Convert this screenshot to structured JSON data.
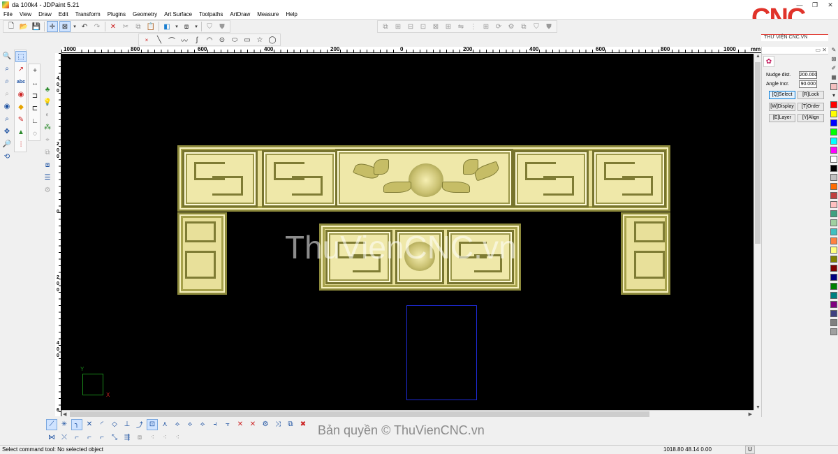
{
  "window": {
    "title": "da 100k4 - JDPaint 5.21",
    "controls": [
      "—",
      "❐",
      "✕"
    ]
  },
  "menu": [
    "File",
    "View",
    "Draw",
    "Edit",
    "Transform",
    "Plugins",
    "Geometry",
    "Art Surface",
    "Toolpaths",
    "ArtDraw",
    "Measure",
    "Help"
  ],
  "ruler": {
    "unit": "mm",
    "labels": [
      "1000",
      "800",
      "600",
      "400",
      "200",
      "0",
      "200",
      "400",
      "600",
      "800",
      "1000",
      "mm"
    ],
    "left_labels": [
      "4",
      "0",
      "0",
      "2",
      "0",
      "0",
      "0",
      "2",
      "0",
      "0",
      "4",
      "0",
      "0",
      "6"
    ]
  },
  "canvas": {
    "watermark": "ThuVienCNC.vn",
    "axis_y": "Y",
    "axis_x": "X"
  },
  "right_panel": {
    "nudge_label": "Nudge dist.",
    "nudge_value": "200.000",
    "angle_label": "Angle Incr.",
    "angle_value": "90.000",
    "buttons": [
      "[Q]Select",
      "[R]Lock",
      "[W]Display",
      "[T]Order",
      "[E]Layer",
      "[Y]Align"
    ]
  },
  "colors": [
    "#ff0000",
    "#ffff00",
    "#0000ff",
    "#00ff00",
    "#00ffff",
    "#ff00ff",
    "#ffffff",
    "#000000",
    "#c0c0c0",
    "#ff6a00",
    "#c04040",
    "#ffc0c0",
    "#40a080",
    "#a0d0a0",
    "#40c0c0",
    "#ff8040",
    "#ffff80",
    "#808000",
    "#800000",
    "#000080",
    "#008000",
    "#008080",
    "#800080",
    "#404080",
    "#808080",
    "#a0a0a0"
  ],
  "copyright": "Bản quyền © ThuVienCNC.vn",
  "status": {
    "message": "Select command tool: No selected object",
    "coords": "1018.80 48.14 0.00",
    "unit_indicator": "U"
  },
  "logo": {
    "text": "CNC",
    "subtitle": "THƯ VIỆN CNC.VN"
  }
}
